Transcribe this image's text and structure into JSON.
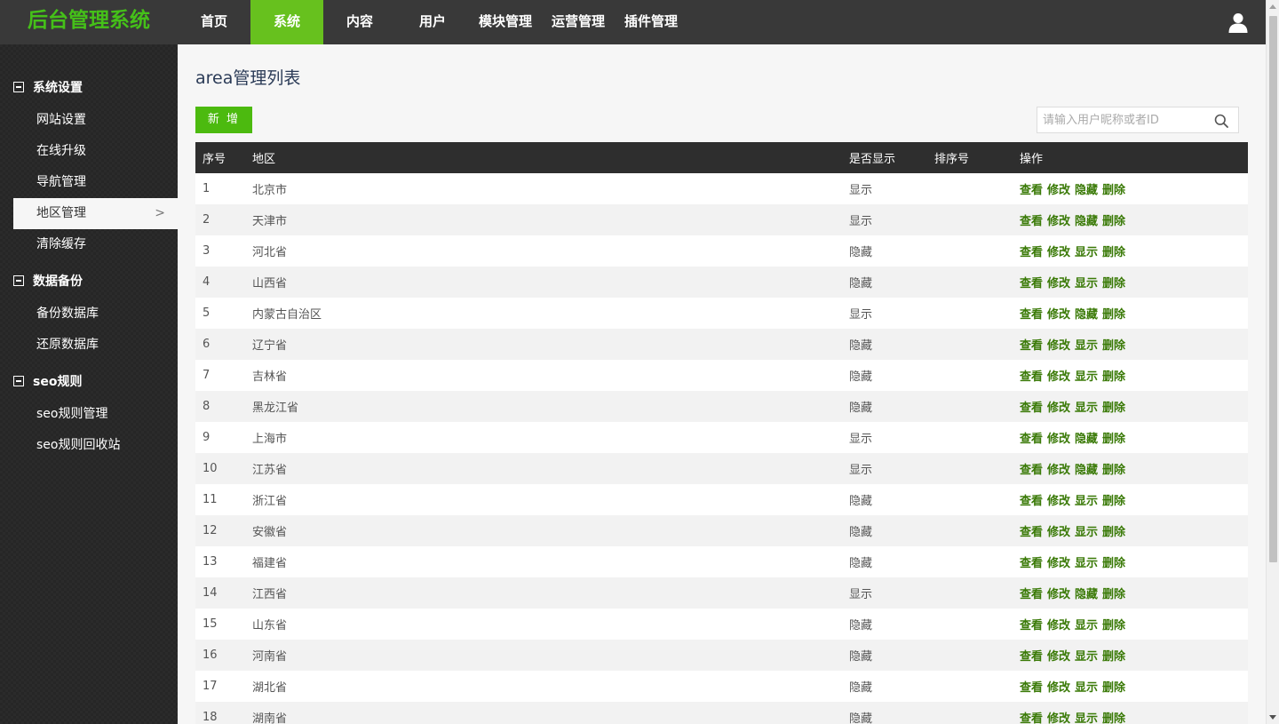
{
  "app": {
    "logo": "后台管理系统"
  },
  "nav": [
    {
      "label": "首页"
    },
    {
      "label": "系统",
      "active": true
    },
    {
      "label": "内容"
    },
    {
      "label": "用户"
    },
    {
      "label": "模块管理"
    },
    {
      "label": "运营管理"
    },
    {
      "label": "插件管理"
    }
  ],
  "sidebar": {
    "groups": [
      {
        "title": "系统设置",
        "items": [
          "网站设置",
          "在线升级",
          "导航管理",
          "地区管理",
          "清除缓存"
        ]
      },
      {
        "title": "数据备份",
        "items": [
          "备份数据库",
          "还原数据库"
        ]
      },
      {
        "title": "seo规则",
        "items": [
          "seo规则管理",
          "seo规则回收站"
        ]
      }
    ],
    "active_item": "地区管理",
    "chevron": ">"
  },
  "main": {
    "title": "area管理列表",
    "add_label": "新 增",
    "search_placeholder": "请输入用户昵称或者ID",
    "columns": [
      "序号",
      "地区",
      "是否显示",
      "排序号",
      "操作"
    ],
    "rows": [
      {
        "id": "1",
        "region": "北京市",
        "shown": "显示",
        "sort": "",
        "ops": [
          "查看",
          "修改",
          "隐藏",
          "删除"
        ]
      },
      {
        "id": "2",
        "region": "天津市",
        "shown": "显示",
        "sort": "",
        "ops": [
          "查看",
          "修改",
          "隐藏",
          "删除"
        ]
      },
      {
        "id": "3",
        "region": "河北省",
        "shown": "隐藏",
        "sort": "",
        "ops": [
          "查看",
          "修改",
          "显示",
          "删除"
        ]
      },
      {
        "id": "4",
        "region": "山西省",
        "shown": "隐藏",
        "sort": "",
        "ops": [
          "查看",
          "修改",
          "显示",
          "删除"
        ]
      },
      {
        "id": "5",
        "region": "内蒙古自治区",
        "shown": "显示",
        "sort": "",
        "ops": [
          "查看",
          "修改",
          "隐藏",
          "删除"
        ]
      },
      {
        "id": "6",
        "region": "辽宁省",
        "shown": "隐藏",
        "sort": "",
        "ops": [
          "查看",
          "修改",
          "显示",
          "删除"
        ]
      },
      {
        "id": "7",
        "region": "吉林省",
        "shown": "隐藏",
        "sort": "",
        "ops": [
          "查看",
          "修改",
          "显示",
          "删除"
        ]
      },
      {
        "id": "8",
        "region": "黑龙江省",
        "shown": "隐藏",
        "sort": "",
        "ops": [
          "查看",
          "修改",
          "显示",
          "删除"
        ]
      },
      {
        "id": "9",
        "region": "上海市",
        "shown": "显示",
        "sort": "",
        "ops": [
          "查看",
          "修改",
          "隐藏",
          "删除"
        ]
      },
      {
        "id": "10",
        "region": "江苏省",
        "shown": "显示",
        "sort": "",
        "ops": [
          "查看",
          "修改",
          "隐藏",
          "删除"
        ]
      },
      {
        "id": "11",
        "region": "浙江省",
        "shown": "隐藏",
        "sort": "",
        "ops": [
          "查看",
          "修改",
          "显示",
          "删除"
        ]
      },
      {
        "id": "12",
        "region": "安徽省",
        "shown": "隐藏",
        "sort": "",
        "ops": [
          "查看",
          "修改",
          "显示",
          "删除"
        ]
      },
      {
        "id": "13",
        "region": "福建省",
        "shown": "隐藏",
        "sort": "",
        "ops": [
          "查看",
          "修改",
          "显示",
          "删除"
        ]
      },
      {
        "id": "14",
        "region": "江西省",
        "shown": "显示",
        "sort": "",
        "ops": [
          "查看",
          "修改",
          "隐藏",
          "删除"
        ]
      },
      {
        "id": "15",
        "region": "山东省",
        "shown": "隐藏",
        "sort": "",
        "ops": [
          "查看",
          "修改",
          "显示",
          "删除"
        ]
      },
      {
        "id": "16",
        "region": "河南省",
        "shown": "隐藏",
        "sort": "",
        "ops": [
          "查看",
          "修改",
          "显示",
          "删除"
        ]
      },
      {
        "id": "17",
        "region": "湖北省",
        "shown": "隐藏",
        "sort": "",
        "ops": [
          "查看",
          "修改",
          "显示",
          "删除"
        ]
      },
      {
        "id": "18",
        "region": "湖南省",
        "shown": "隐藏",
        "sort": "",
        "ops": [
          "查看",
          "修改",
          "显示",
          "删除"
        ]
      }
    ]
  },
  "icons": {
    "user": "user-icon",
    "search": "search-icon",
    "collapse": "minus-square-icon"
  },
  "colors": {
    "accent": "#45c019",
    "nav_active": "#67c11e",
    "button": "#4cba0f",
    "link": "#3a7a07",
    "topbar": "#393939"
  }
}
